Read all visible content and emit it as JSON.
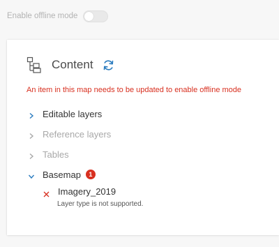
{
  "offline": {
    "label": "Enable offline mode",
    "enabled": false
  },
  "content": {
    "title": "Content",
    "error_message": "An item in this map needs to be updated to enable offline mode",
    "groups": [
      {
        "label": "Editable layers",
        "state": "active",
        "expanded": false
      },
      {
        "label": "Reference layers",
        "state": "disabled",
        "expanded": false
      },
      {
        "label": "Tables",
        "state": "disabled",
        "expanded": false
      },
      {
        "label": "Basemap",
        "state": "active",
        "expanded": true,
        "badge": "1"
      }
    ],
    "basemap_layer": {
      "name": "Imagery_2019",
      "status_icon": "error-x-icon",
      "note": "Layer type is not supported."
    }
  },
  "colors": {
    "accent": "#2a7bbf",
    "error": "#d83020",
    "disabled_text": "#a8a8a8"
  }
}
